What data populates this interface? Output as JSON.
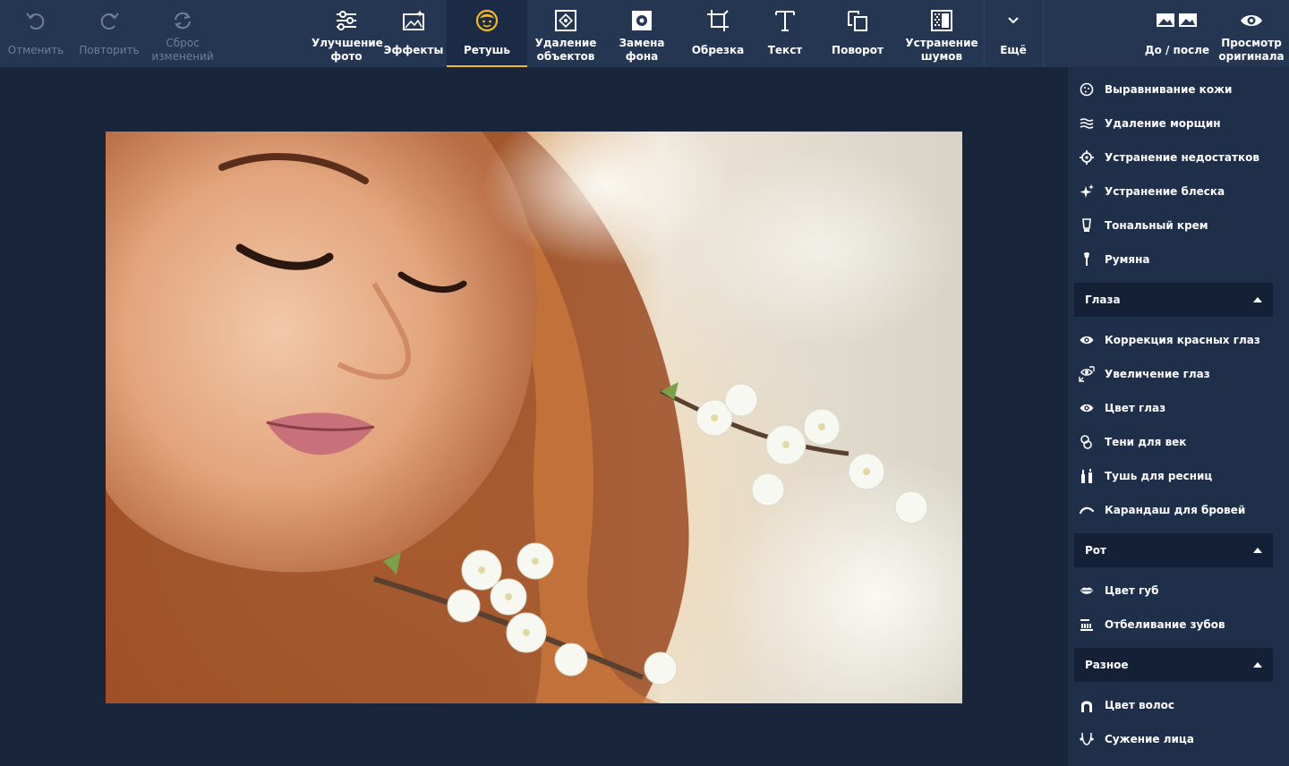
{
  "toolbar": {
    "undo": "Отменить",
    "redo": "Повторить",
    "reset": [
      "Сброс",
      "изменений"
    ],
    "enhance": [
      "Улучшение",
      "фото"
    ],
    "effects": "Эффекты",
    "retouch": "Ретушь",
    "remove_objects": [
      "Удаление",
      "объектов"
    ],
    "replace_bg": [
      "Замена",
      "фона"
    ],
    "crop": "Обрезка",
    "text": "Текст",
    "rotate": "Поворот",
    "denoise": [
      "Устранение",
      "шумов"
    ],
    "more": "Ещё",
    "before_after": "До / после",
    "view_original": [
      "Просмотр",
      "оригинала"
    ],
    "accent_color": "#f5b921"
  },
  "panel": {
    "skin_items": [
      {
        "label": "Выравнивание кожи",
        "icon": "smooth-skin-icon"
      },
      {
        "label": "Удаление морщин",
        "icon": "wrinkles-icon"
      },
      {
        "label": "Устранение недостатков",
        "icon": "blemish-target-icon"
      },
      {
        "label": "Устранение блеска",
        "icon": "sparkle-icon"
      },
      {
        "label": "Тональный крем",
        "icon": "foundation-icon"
      },
      {
        "label": "Румяна",
        "icon": "blush-brush-icon"
      }
    ],
    "eyes_section": "Глаза",
    "eyes_items": [
      {
        "label": "Коррекция красных глаз",
        "icon": "eye-icon"
      },
      {
        "label": "Увеличение глаз",
        "icon": "eye-enlarge-icon"
      },
      {
        "label": "Цвет глаз",
        "icon": "eye-color-icon"
      },
      {
        "label": "Тени для век",
        "icon": "eyeshadow-icon"
      },
      {
        "label": "Тушь для ресниц",
        "icon": "mascara-icon"
      },
      {
        "label": "Карандаш для бровей",
        "icon": "eyebrow-icon"
      }
    ],
    "mouth_section": "Рот",
    "mouth_items": [
      {
        "label": "Цвет губ",
        "icon": "lips-icon"
      },
      {
        "label": "Отбеливание зубов",
        "icon": "teeth-icon"
      }
    ],
    "misc_section": "Разное",
    "misc_items": [
      {
        "label": "Цвет волос",
        "icon": "hair-icon"
      },
      {
        "label": "Сужение лица",
        "icon": "face-slim-icon"
      }
    ]
  }
}
